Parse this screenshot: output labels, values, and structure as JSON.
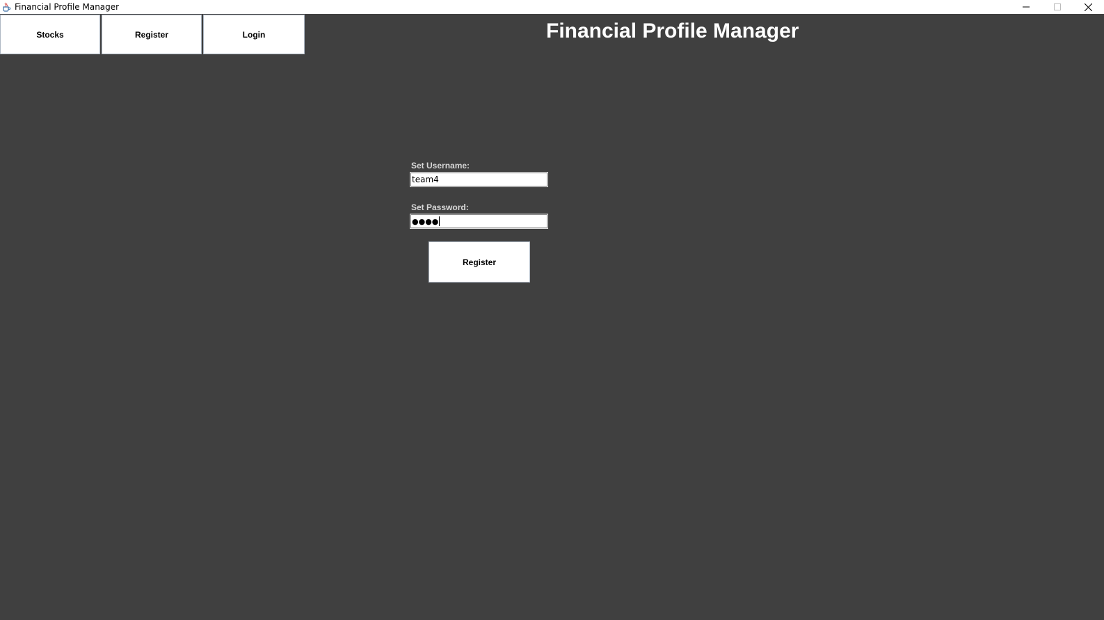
{
  "window": {
    "title": "Financial Profile Manager",
    "icon": "java-cup-icon"
  },
  "nav": {
    "items": [
      {
        "label": "Stocks"
      },
      {
        "label": "Register"
      },
      {
        "label": "Login"
      }
    ]
  },
  "header": {
    "title": "Financial Profile Manager"
  },
  "form": {
    "username_label": "Set Username:",
    "username_value": "team4",
    "password_label": "Set Password:",
    "password_masked": "●●●●",
    "submit_label": "Register"
  },
  "colors": {
    "background": "#404040",
    "button_bg": "#ffffff",
    "title_text": "#ffffff"
  }
}
